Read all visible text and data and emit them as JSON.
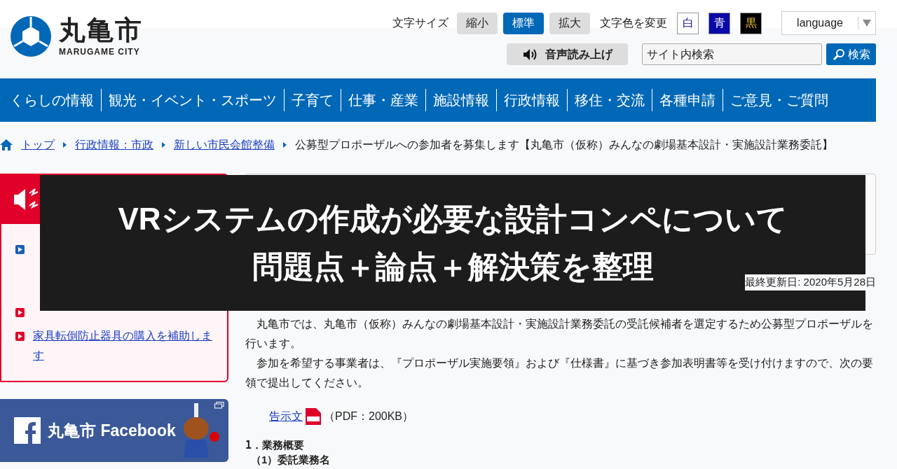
{
  "header": {
    "logo_name": "丸亀市",
    "logo_sub": "MARUGAME CITY",
    "font_size_label": "文字サイズ",
    "font_sizes": [
      {
        "label": "縮小",
        "selected": false
      },
      {
        "label": "標準",
        "selected": true
      },
      {
        "label": "拡大",
        "selected": false
      }
    ],
    "color_label": "文字色を変更",
    "color_options": [
      {
        "label": "白",
        "color": "#ffffff"
      },
      {
        "label": "青",
        "color": "#0a0aa8"
      },
      {
        "label": "黒",
        "color": "#000000"
      }
    ],
    "language": "language",
    "speech_button": "音声読み上げ",
    "search": {
      "placeholder": "サイト内検索",
      "button": "検索"
    }
  },
  "nav": [
    "くらしの情報",
    "観光・イベント・スポーツ",
    "子育て",
    "仕事・産業",
    "施設情報",
    "行政情報",
    "移住・交流",
    "各種申請",
    "ご意見・ご質問"
  ],
  "breadcrumb": {
    "links": [
      "トップ",
      "行政情報：市政",
      "新しい市民会館整備"
    ],
    "current": "公募型プロポーザルへの参加者を募集します【丸亀市（仮称）みんなの劇場基本設計・実施設計業務委託】"
  },
  "sidebar": {
    "emergency": {
      "items": [
        {
          "color": "#1a5fb4"
        },
        {
          "color": "#e0002a"
        },
        {
          "link": "家具転倒防止器具の購入を補助します",
          "color": "#e0002a"
        }
      ]
    },
    "facebook": "丸亀市 Facebook"
  },
  "article": {
    "updated": "最終更新日: 2020年5月28日",
    "paragraphs": [
      "丸亀市では、丸亀市（仮称）みんなの劇場基本設計・実施設計業務委託の受託候補者を選定するため公募型プロポーザルを行います。",
      "参加を希望する事業者は、『プロポーザル実施要領』および『仕様書』に基づき参加表明書等を受け付けますので、次の要領で提出してください。"
    ],
    "attachment": {
      "link": "告示文",
      "info": "（PDF：200KB）"
    },
    "heading": "1．業務概要",
    "subheading": "（1）委託業務名"
  },
  "overlay": {
    "lines": [
      "VRシステムの作成が必要な設計コンペについて",
      "問題点＋論点＋解決策を整理"
    ]
  }
}
